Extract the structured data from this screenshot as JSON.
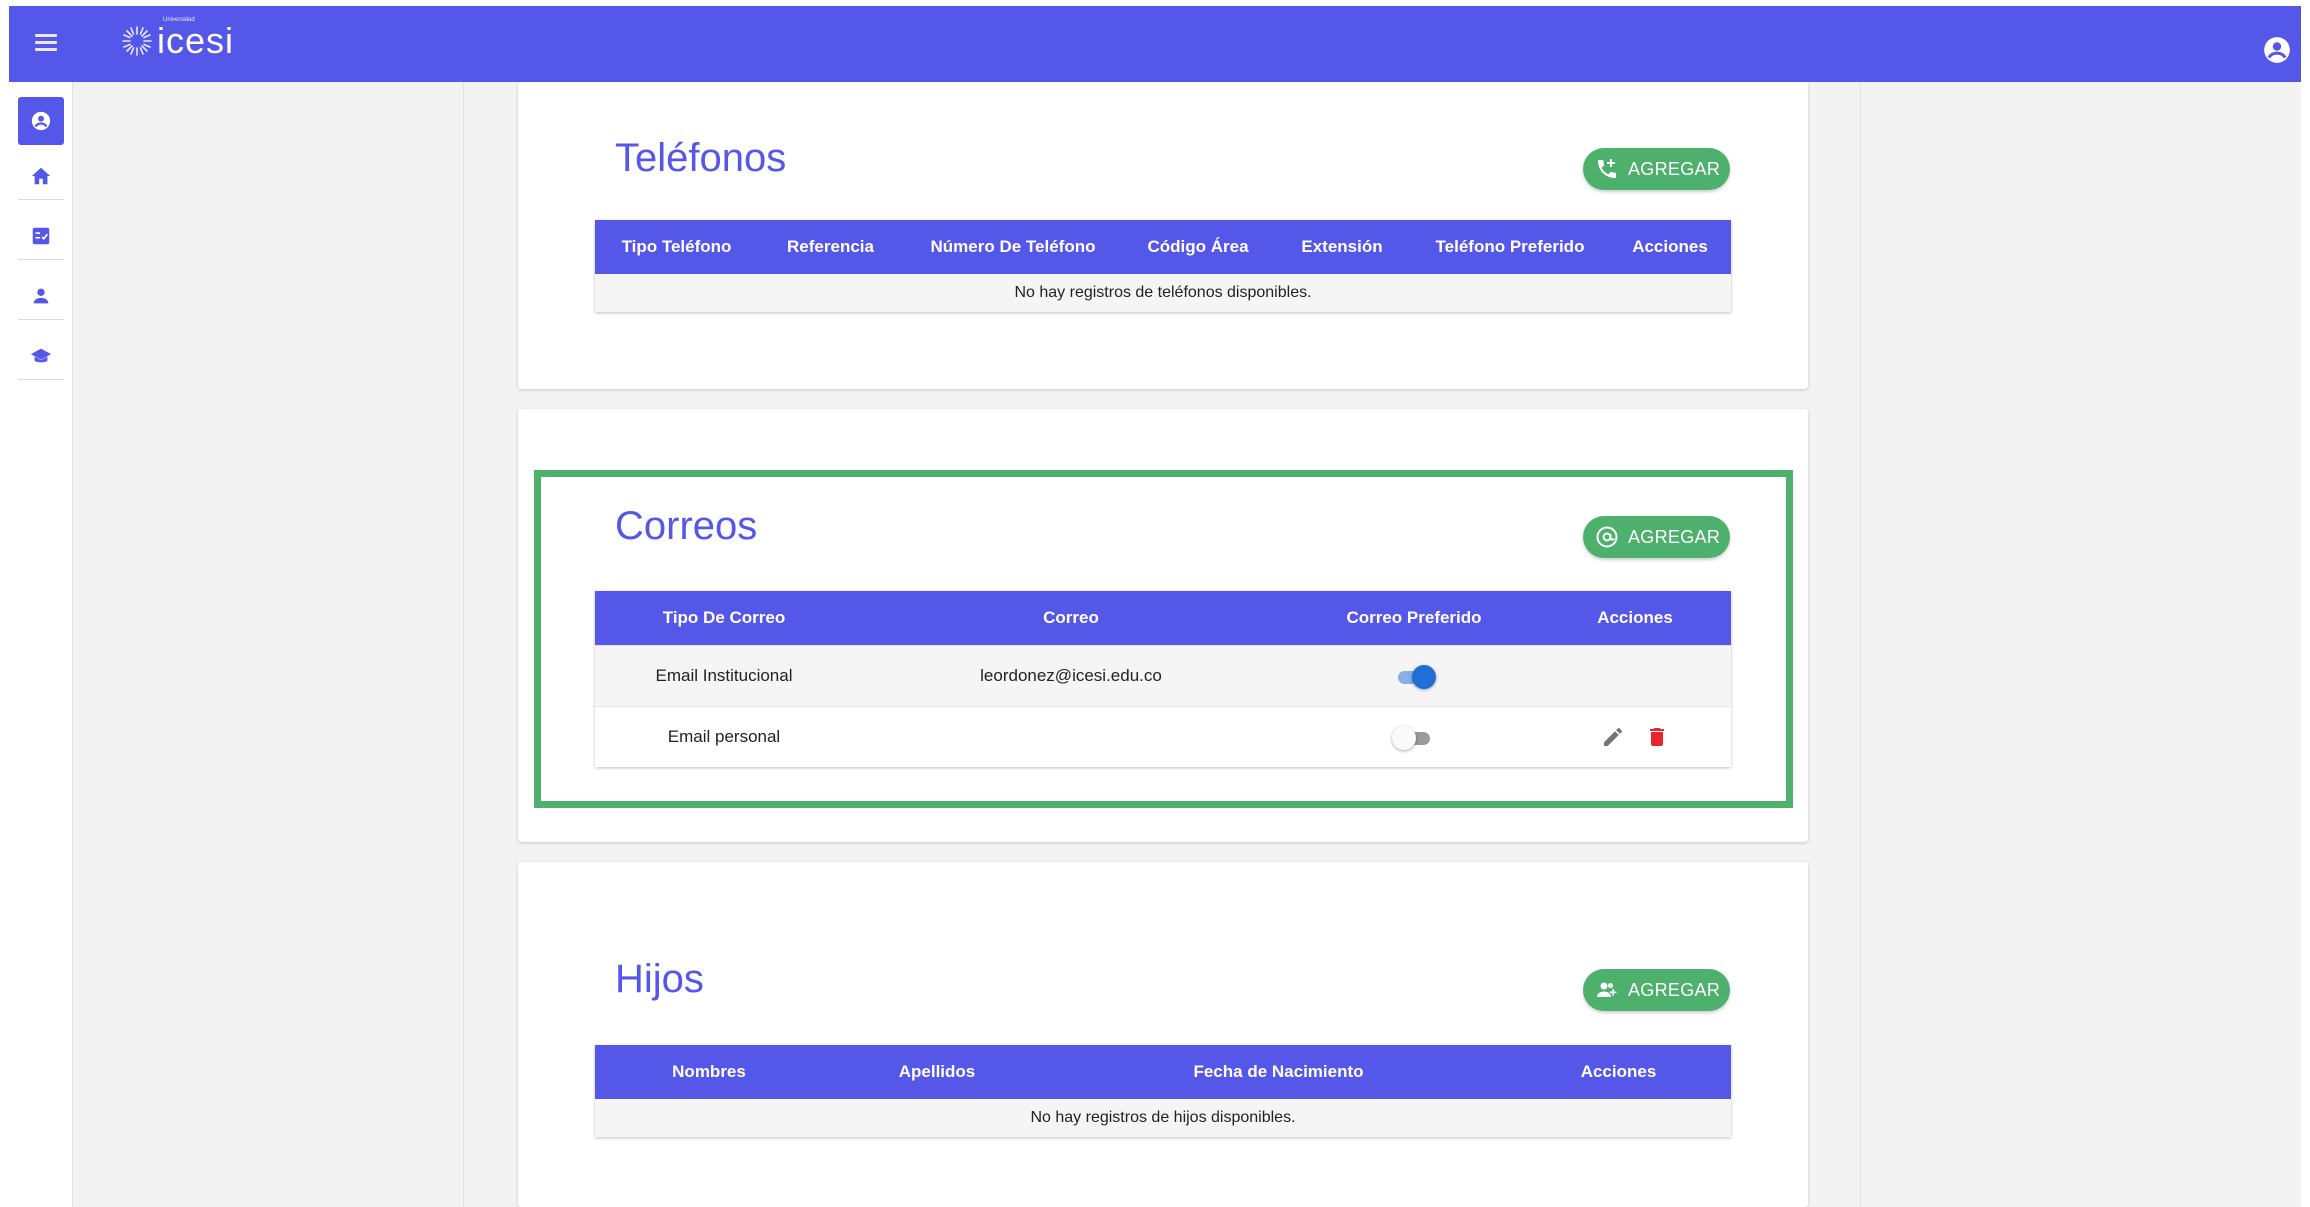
{
  "header": {
    "logo_small": "Universidad",
    "logo_text": "icesi"
  },
  "sidebar": {
    "items": [
      {
        "name": "profile",
        "icon": "account-circle-icon"
      },
      {
        "name": "home",
        "icon": "home-icon"
      },
      {
        "name": "tasks",
        "icon": "checklist-icon"
      },
      {
        "name": "person",
        "icon": "person-icon"
      },
      {
        "name": "academic",
        "icon": "graduation-cap-icon"
      }
    ]
  },
  "telefonos": {
    "title": "Teléfonos",
    "add_label": "AGREGAR",
    "add_icon": "add-phone-icon",
    "columns": [
      "Tipo Teléfono",
      "Referencia",
      "Número De Teléfono",
      "Código Área",
      "Extensión",
      "Teléfono Preferido",
      "Acciones"
    ],
    "empty_message": "No hay registros de teléfonos disponibles."
  },
  "correos": {
    "title": "Correos",
    "add_label": "AGREGAR",
    "add_icon": "at-sign-icon",
    "columns": [
      "Tipo De Correo",
      "Correo",
      "Correo Preferido",
      "Acciones"
    ],
    "rows": [
      {
        "tipo": "Email Institucional",
        "correo": "leordonez@icesi.edu.co",
        "preferido": true,
        "has_actions": false
      },
      {
        "tipo": "Email personal",
        "correo": "",
        "preferido": false,
        "has_actions": true
      }
    ]
  },
  "hijos": {
    "title": "Hijos",
    "add_label": "AGREGAR",
    "add_icon": "add-user-icon",
    "columns": [
      "Nombres",
      "Apellidos",
      "Fecha de Nacimiento",
      "Acciones"
    ],
    "empty_message": "No hay registros de hijos disponibles."
  },
  "colors": {
    "primary": "#5457e8",
    "success": "#4db06c",
    "danger": "#e8262c",
    "toggle_on": "#1f6fd6"
  }
}
